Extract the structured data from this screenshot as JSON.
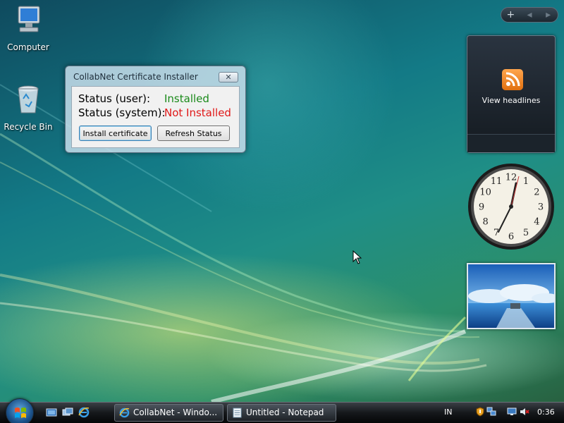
{
  "desktop": {
    "icons": [
      {
        "label": "Computer"
      },
      {
        "label": "Recycle Bin"
      }
    ]
  },
  "sidebar": {
    "controls": [
      "+",
      "◂",
      "▸"
    ],
    "feed_gadget": {
      "label": "View headlines"
    },
    "clock": {
      "numbers": [
        "12",
        "1",
        "2",
        "3",
        "4",
        "5",
        "6",
        "7",
        "8",
        "9",
        "10",
        "11"
      ]
    }
  },
  "dialog": {
    "title": "CollabNet Certificate Installer",
    "close_glyph": "✕",
    "status_user_label": "Status (user):",
    "status_user_value": "Installed",
    "status_system_label": "Status (system):",
    "status_system_value": "Not Installed",
    "install_button": "Install certificate",
    "refresh_button": "Refresh Status",
    "colors": {
      "installed": "#1a8a1a",
      "not_installed": "#e01818"
    }
  },
  "taskbar": {
    "quick_launch": [
      "show-desktop-icon",
      "switch-windows-icon",
      "internet-explorer-icon"
    ],
    "tasks": [
      {
        "label": "CollabNet - Windo...",
        "icon": "internet-explorer-icon"
      },
      {
        "label": "Untitled - Notepad",
        "icon": "notepad-icon"
      }
    ],
    "tray": {
      "language": "IN",
      "time": "0:36",
      "icons": [
        "security-shield-icon",
        "network-icon",
        "display-icon",
        "volume-muted-icon"
      ]
    }
  }
}
